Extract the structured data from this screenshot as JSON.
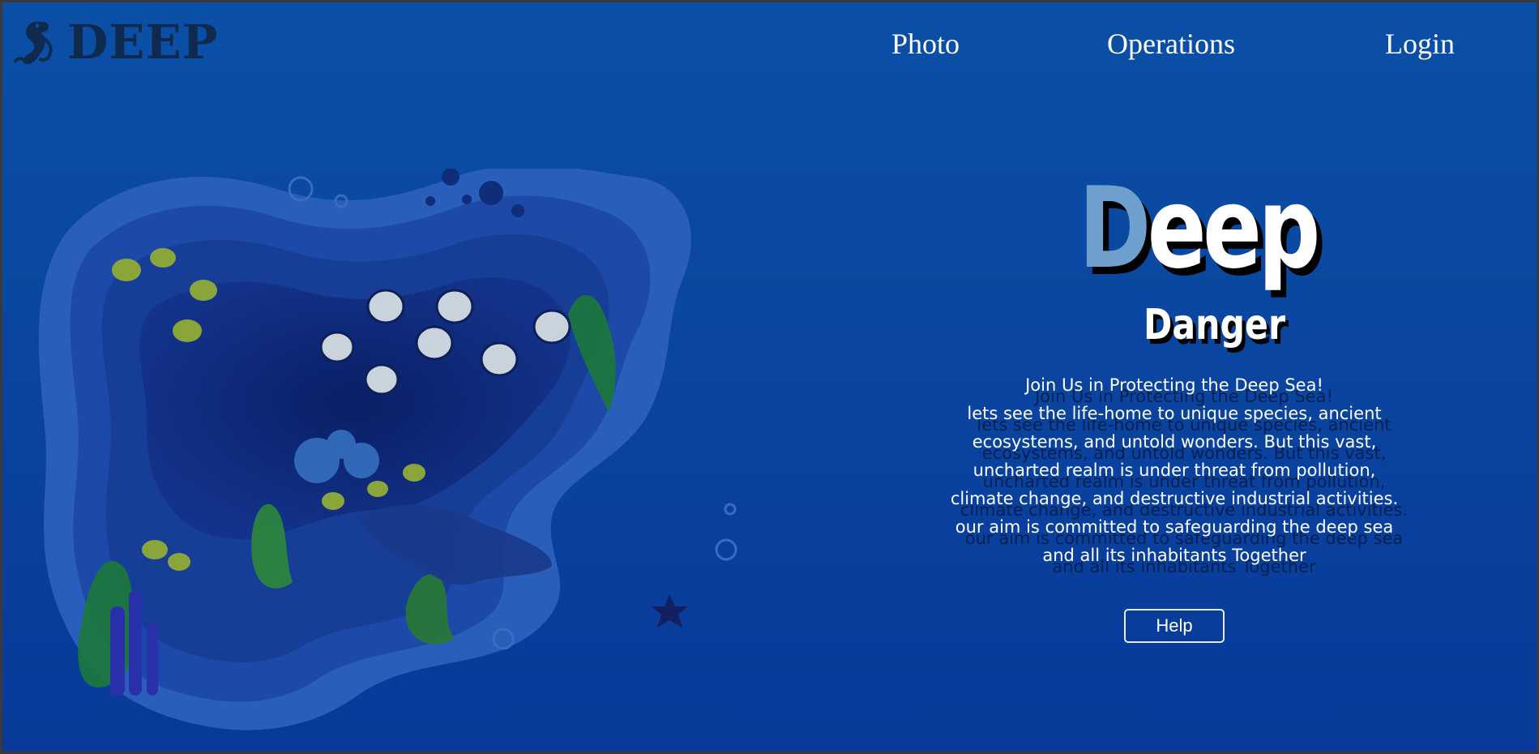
{
  "header": {
    "logo_text": "DEEP",
    "nav": [
      {
        "label": "Photo"
      },
      {
        "label": "Operations"
      },
      {
        "label": "Login"
      }
    ]
  },
  "hero": {
    "title_first_letter": "D",
    "title_rest": "eep",
    "subtitle": "Danger",
    "lines": [
      "Join Us in Protecting the Deep Sea!",
      "lets see the life-home to unique species, ancient",
      "ecosystems, and untold wonders. But this vast,",
      "uncharted realm is under threat from pollution,",
      "climate change, and destructive industrial activities.",
      "our aim is committed to safeguarding the deep sea",
      "and all its inhabitants Together"
    ],
    "help_label": "Help"
  },
  "colors": {
    "background_top": "#0a4fa6",
    "background_bottom": "#08399a",
    "title_accent": "#6f9fcc",
    "logo": "#102a4d"
  },
  "icons": {
    "logo": "seahorse-icon"
  }
}
